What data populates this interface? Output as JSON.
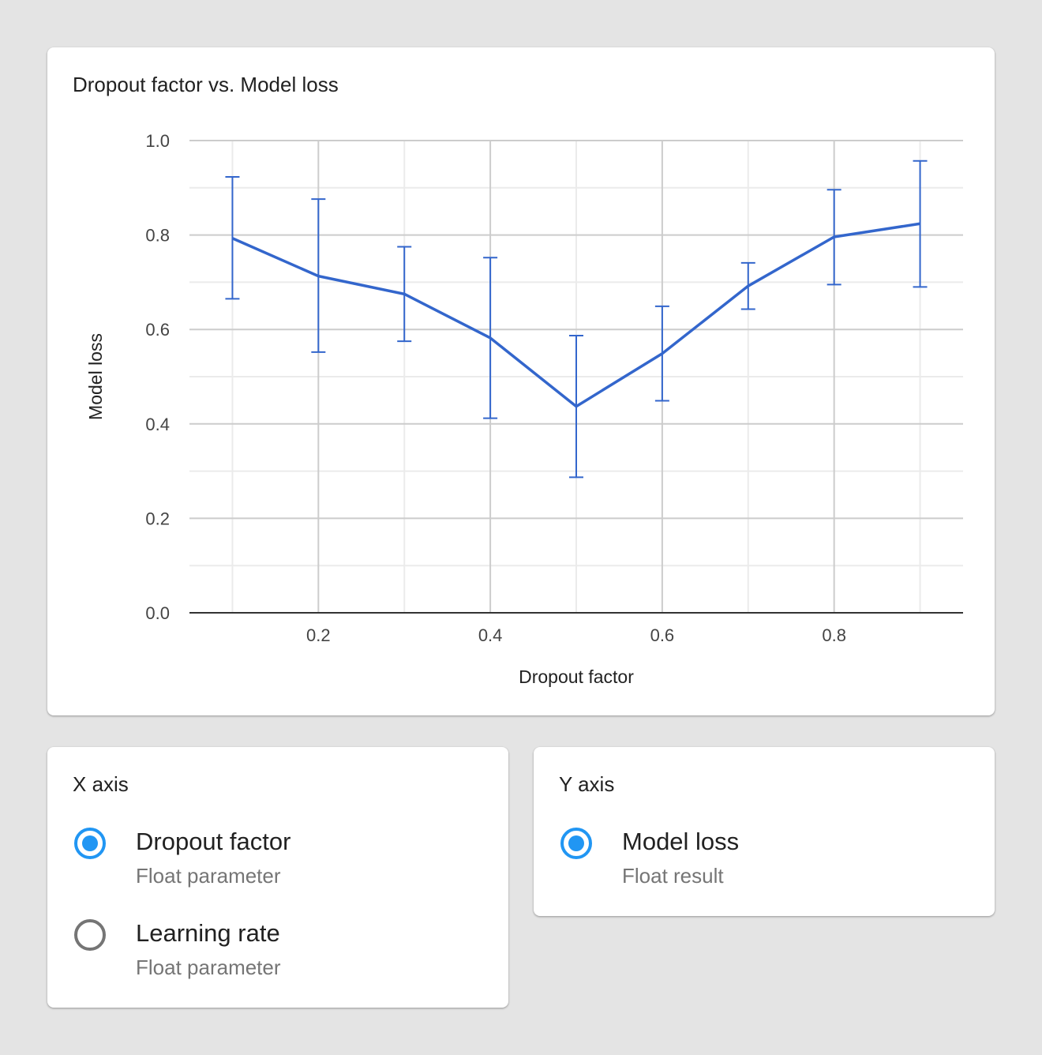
{
  "chart_card": {
    "title": "Dropout factor vs. Model loss"
  },
  "chart_data": {
    "type": "line",
    "title": "Dropout factor vs. Model loss",
    "xlabel": "Dropout factor",
    "ylabel": "Model loss",
    "xlim": [
      0.05,
      0.95
    ],
    "ylim": [
      0.0,
      1.0
    ],
    "x_ticks": [
      0.2,
      0.4,
      0.6,
      0.8
    ],
    "x_tick_labels": [
      "0.2",
      "0.4",
      "0.6",
      "0.8"
    ],
    "y_ticks": [
      0.0,
      0.2,
      0.4,
      0.6,
      0.8,
      1.0
    ],
    "y_tick_labels": [
      "0.0",
      "0.2",
      "0.4",
      "0.6",
      "0.8",
      "1.0"
    ],
    "grid": true,
    "series": [
      {
        "color": "#3366cc",
        "points": [
          {
            "x": 0.1,
            "y": 0.793,
            "low": 0.665,
            "high": 0.923
          },
          {
            "x": 0.2,
            "y": 0.713,
            "low": 0.552,
            "high": 0.876
          },
          {
            "x": 0.3,
            "y": 0.675,
            "low": 0.575,
            "high": 0.775
          },
          {
            "x": 0.4,
            "y": 0.582,
            "low": 0.412,
            "high": 0.752
          },
          {
            "x": 0.5,
            "y": 0.437,
            "low": 0.287,
            "high": 0.587
          },
          {
            "x": 0.6,
            "y": 0.549,
            "low": 0.449,
            "high": 0.649
          },
          {
            "x": 0.7,
            "y": 0.692,
            "low": 0.643,
            "high": 0.741
          },
          {
            "x": 0.8,
            "y": 0.796,
            "low": 0.695,
            "high": 0.896
          },
          {
            "x": 0.9,
            "y": 0.824,
            "low": 0.69,
            "high": 0.957
          }
        ]
      }
    ]
  },
  "x_axis_panel": {
    "title": "X axis",
    "options": [
      {
        "label": "Dropout factor",
        "sub": "Float parameter",
        "checked": true
      },
      {
        "label": "Learning rate",
        "sub": "Float parameter",
        "checked": false
      }
    ]
  },
  "y_axis_panel": {
    "title": "Y axis",
    "options": [
      {
        "label": "Model loss",
        "sub": "Float result",
        "checked": true
      }
    ]
  },
  "colors": {
    "accent": "#2196f3",
    "series": "#3366cc",
    "background": "#e4e4e4"
  }
}
